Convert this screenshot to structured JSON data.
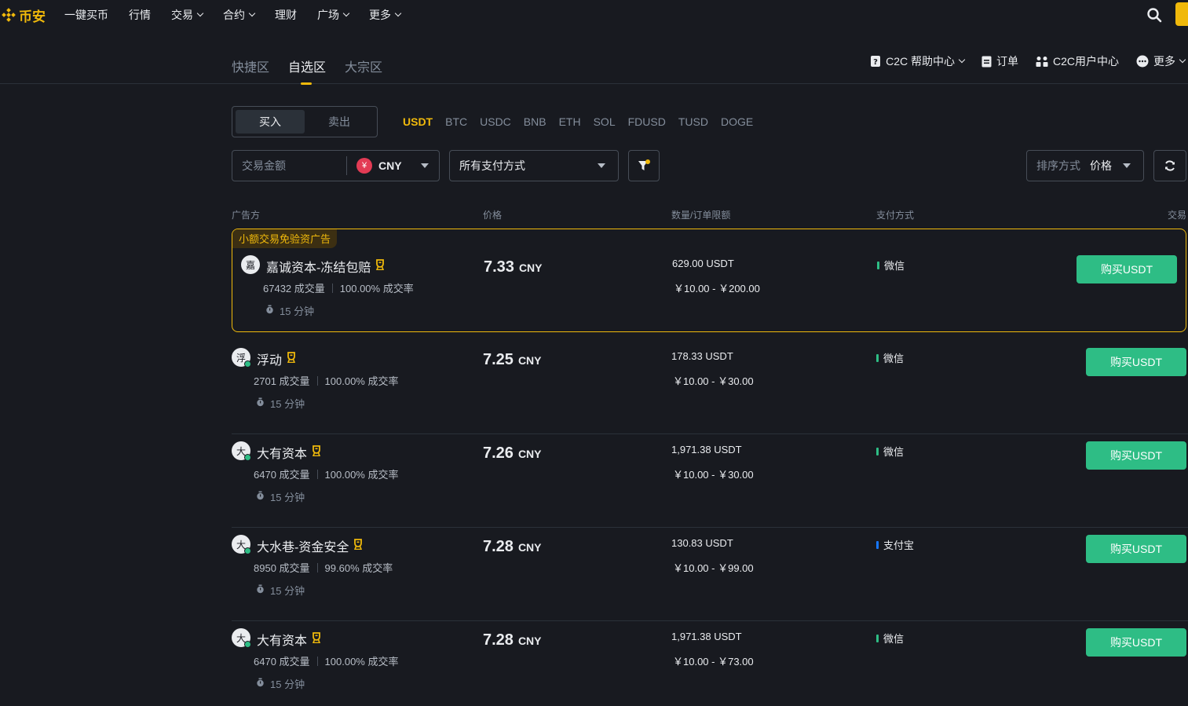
{
  "brand": {
    "name": "币安",
    "color": "#f0b90b"
  },
  "nav": {
    "items": [
      {
        "label": "一键买币",
        "dropdown": false
      },
      {
        "label": "行情",
        "dropdown": false
      },
      {
        "label": "交易",
        "dropdown": true
      },
      {
        "label": "合约",
        "dropdown": true
      },
      {
        "label": "理财",
        "dropdown": false
      },
      {
        "label": "广场",
        "dropdown": true
      },
      {
        "label": "更多",
        "dropdown": true
      }
    ]
  },
  "subnav": {
    "tabs": [
      {
        "label": "快捷区",
        "active": false
      },
      {
        "label": "自选区",
        "active": true
      },
      {
        "label": "大宗区",
        "active": false
      }
    ],
    "links": {
      "help": "C2C 帮助中心",
      "orders": "订单",
      "user_center": "C2C用户中心",
      "more": "更多"
    }
  },
  "trade_toggle": {
    "buy": "买入",
    "sell": "卖出",
    "active": "buy"
  },
  "coins": [
    "USDT",
    "BTC",
    "USDC",
    "BNB",
    "ETH",
    "SOL",
    "FDUSD",
    "TUSD",
    "DOGE"
  ],
  "active_coin": "USDT",
  "filters": {
    "amount_placeholder": "交易金额",
    "currency": "CNY",
    "currency_symbol": "¥",
    "payment": "所有支付方式",
    "sort_label": "排序方式",
    "sort_value": "价格"
  },
  "table": {
    "headers": {
      "advertiser": "广告方",
      "price": "价格",
      "quantity": "数量/订单限额",
      "payment": "支付方式",
      "trade": "交易"
    }
  },
  "featured_tag": "小额交易免验资广告",
  "rows": [
    {
      "avatar": "嘉",
      "online": false,
      "merchant": "嘉诚资本-冻结包赔",
      "orders": "67432 成交量",
      "completion": "100.00% 成交率",
      "time": "15 分钟",
      "price": "7.33",
      "currency": "CNY",
      "quantity": "629.00 USDT",
      "limit": "￥10.00 - ￥200.00",
      "payment": "微信",
      "payment_color": "#2ebd85",
      "button": "购买USDT",
      "featured": true
    },
    {
      "avatar": "浮",
      "online": true,
      "merchant": "浮动",
      "orders": "2701 成交量",
      "completion": "100.00% 成交率",
      "time": "15 分钟",
      "price": "7.25",
      "currency": "CNY",
      "quantity": "178.33 USDT",
      "limit": "￥10.00 - ￥30.00",
      "payment": "微信",
      "payment_color": "#2ebd85",
      "button": "购买USDT",
      "featured": false
    },
    {
      "avatar": "大",
      "online": true,
      "merchant": "大有资本",
      "orders": "6470 成交量",
      "completion": "100.00% 成交率",
      "time": "15 分钟",
      "price": "7.26",
      "currency": "CNY",
      "quantity": "1,971.38 USDT",
      "limit": "￥10.00 - ￥30.00",
      "payment": "微信",
      "payment_color": "#2ebd85",
      "button": "购买USDT",
      "featured": false
    },
    {
      "avatar": "大",
      "online": true,
      "merchant": "大水巷-资金安全",
      "orders": "8950 成交量",
      "completion": "99.60% 成交率",
      "time": "15 分钟",
      "price": "7.28",
      "currency": "CNY",
      "quantity": "130.83 USDT",
      "limit": "￥10.00 - ￥99.00",
      "payment": "支付宝",
      "payment_color": "#1677ff",
      "button": "购买USDT",
      "featured": false
    },
    {
      "avatar": "大",
      "online": true,
      "merchant": "大有资本",
      "orders": "6470 成交量",
      "completion": "100.00% 成交率",
      "time": "15 分钟",
      "price": "7.28",
      "currency": "CNY",
      "quantity": "1,971.38 USDT",
      "limit": "￥10.00 - ￥73.00",
      "payment": "微信",
      "payment_color": "#2ebd85",
      "button": "购买USDT",
      "featured": false
    }
  ]
}
